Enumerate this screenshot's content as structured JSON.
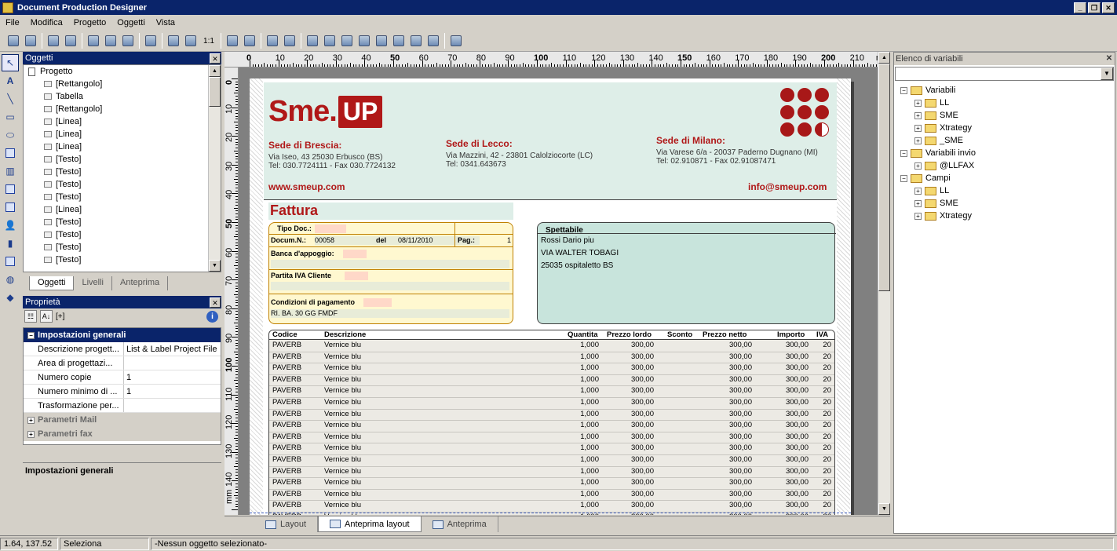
{
  "window": {
    "title": "Document Production Designer"
  },
  "menu": [
    "File",
    "Modifica",
    "Progetto",
    "Oggetti",
    "Vista"
  ],
  "toolbar": {
    "zoom_label": "1:1"
  },
  "objects_panel": {
    "title": "Oggetti",
    "root": "Progetto",
    "items": [
      "[Rettangolo]",
      "Tabella",
      "[Rettangolo]",
      "[Linea]",
      "[Linea]",
      "[Linea]",
      "[Testo]",
      "[Testo]",
      "[Testo]",
      "[Testo]",
      "[Linea]",
      "[Testo]",
      "[Testo]",
      "[Testo]",
      "[Testo]"
    ],
    "tabs": [
      {
        "label": "Oggetti",
        "active": true
      },
      {
        "label": "Livelli",
        "active": false
      },
      {
        "label": "Anteprima",
        "active": false
      }
    ]
  },
  "properties_panel": {
    "title": "Proprietà",
    "sort_label": "[+]",
    "category_general": "Impostazioni generali",
    "rows": [
      {
        "key": "Descrizione progett...",
        "value": "List & Label Project File"
      },
      {
        "key": "Area di progettazi...",
        "value": ""
      },
      {
        "key": "Numero copie",
        "value": "1"
      },
      {
        "key": "Numero minimo di ...",
        "value": "1"
      },
      {
        "key": "Trasformazione per...",
        "value": ""
      }
    ],
    "category_mail": "Parametri Mail",
    "category_fax": "Parametri fax",
    "description": "Impostazioni generali"
  },
  "ruler": {
    "h_labels": [
      "0",
      "10",
      "20",
      "30",
      "40",
      "50",
      "60",
      "70",
      "80",
      "90",
      "100",
      "110",
      "120",
      "130",
      "140",
      "150",
      "160",
      "170",
      "180",
      "190",
      "200",
      "210",
      "mm"
    ],
    "v_labels": [
      "0",
      "10",
      "20",
      "30",
      "40",
      "50",
      "60",
      "70",
      "80",
      "90",
      "100",
      "110",
      "120",
      "130",
      "140",
      "mm"
    ]
  },
  "document": {
    "logo_sme": "Sme.",
    "logo_up": "UP",
    "sede_brescia": {
      "name": "Sede di Brescia:",
      "addr": "Via Iseo, 43    25030 Erbusco (BS)",
      "tel": "Tel: 030.7724111 - Fax 030.7724132"
    },
    "sede_lecco": {
      "name": "Sede di Lecco:",
      "addr": "Via Mazzini, 42 - 23801 Calolziocorte (LC)",
      "tel": "Tel: 0341.643673"
    },
    "sede_milano": {
      "name": "Sede di Milano:",
      "addr": "Via Varese 6/a - 20037 Paderno Dugnano (MI)",
      "tel": "Tel: 02.910871 - Fax 02.91087471"
    },
    "web": "www.smeup.com",
    "email": "info@smeup.com",
    "doc_title": "Fattura",
    "tipo_doc_label": "Tipo Doc.:",
    "docum_label": "Docum.N.:",
    "docum_value": "00058",
    "del_label": "del",
    "del_value": "08/11/2010",
    "pag_label": "Pag.:",
    "pag_value": "1",
    "banca_label": "Banca d'appoggio:",
    "piva_label": "Partita IVA Cliente",
    "condizioni_label": "Condizioni di pagamento",
    "condizioni_value": "RI. BA. 30 GG FMDF",
    "spett_label": "Spettabile",
    "spett_lines": [
      "Rossi Dario piu",
      "VIA WALTER TOBAGI",
      "25035 ospitaletto BS"
    ]
  },
  "table": {
    "headers": [
      "Codice",
      "Descrizione",
      "Quantita",
      "Prezzo lordo",
      "Sconto",
      "Prezzo netto",
      "Importo",
      "IVA"
    ],
    "rows": [
      [
        "PAVERB",
        "Vernice blu",
        "1,000",
        "300,00",
        "300,00",
        "300,00",
        "20"
      ],
      [
        "PAVERB",
        "Vernice blu",
        "1,000",
        "300,00",
        "300,00",
        "300,00",
        "20"
      ],
      [
        "PAVERB",
        "Vernice blu",
        "1,000",
        "300,00",
        "300,00",
        "300,00",
        "20"
      ],
      [
        "PAVERB",
        "Vernice blu",
        "1,000",
        "300,00",
        "300,00",
        "300,00",
        "20"
      ],
      [
        "PAVERB",
        "Vernice blu",
        "1,000",
        "300,00",
        "300,00",
        "300,00",
        "20"
      ],
      [
        "PAVERB",
        "Vernice blu",
        "1,000",
        "300,00",
        "300,00",
        "300,00",
        "20"
      ],
      [
        "PAVERB",
        "Vernice blu",
        "1,000",
        "300,00",
        "300,00",
        "300,00",
        "20"
      ],
      [
        "PAVERB",
        "Vernice blu",
        "1,000",
        "300,00",
        "300,00",
        "300,00",
        "20"
      ],
      [
        "PAVERB",
        "Vernice blu",
        "1,000",
        "300,00",
        "300,00",
        "300,00",
        "20"
      ],
      [
        "PAVERB",
        "Vernice blu",
        "1,000",
        "300,00",
        "300,00",
        "300,00",
        "20"
      ],
      [
        "PAVERB",
        "Vernice blu",
        "1,000",
        "300,00",
        "300,00",
        "300,00",
        "20"
      ],
      [
        "PAVERB",
        "Vernice blu",
        "1,000",
        "300,00",
        "300,00",
        "300,00",
        "20"
      ],
      [
        "PAVERB",
        "Vernice blu",
        "1,000",
        "300,00",
        "300,00",
        "300,00",
        "20"
      ],
      [
        "PAVERB",
        "Vernice blu",
        "1,000",
        "300,00",
        "300,00",
        "300,00",
        "20"
      ],
      [
        "PAVERB",
        "Vernice blu",
        "1,000",
        "300,00",
        "300,00",
        "300,00",
        "20"
      ],
      [
        "PAVERB",
        "Vernice blu",
        "1,000",
        "300,00",
        "300,00",
        "300,00",
        "20"
      ]
    ]
  },
  "bottom_tabs": [
    {
      "label": "Layout",
      "active": false
    },
    {
      "label": "Anteprima layout",
      "active": true
    },
    {
      "label": "Anteprima",
      "active": false
    }
  ],
  "variables_panel": {
    "title": "Elenco di variabili",
    "tree": [
      {
        "label": "Variabili",
        "level": 0,
        "expanded": true
      },
      {
        "label": "LL",
        "level": 1
      },
      {
        "label": "SME",
        "level": 1
      },
      {
        "label": "Xtrategy",
        "level": 1
      },
      {
        "label": "_SME",
        "level": 1
      },
      {
        "label": "Variabili invio",
        "level": 0,
        "expanded": true
      },
      {
        "label": "@LLFAX",
        "level": 1
      },
      {
        "label": "Campi",
        "level": 0,
        "expanded": true
      },
      {
        "label": "LL",
        "level": 1
      },
      {
        "label": "SME",
        "level": 1
      },
      {
        "label": "Xtrategy",
        "level": 1
      }
    ]
  },
  "status": {
    "coords": "1.64, 137.52",
    "mode": "Seleziona",
    "message": "-Nessun oggetto selezionato-"
  },
  "colors": {
    "brand_red": "#b01818",
    "title_blue": "#0a246a",
    "header_band": "#deeee8"
  }
}
